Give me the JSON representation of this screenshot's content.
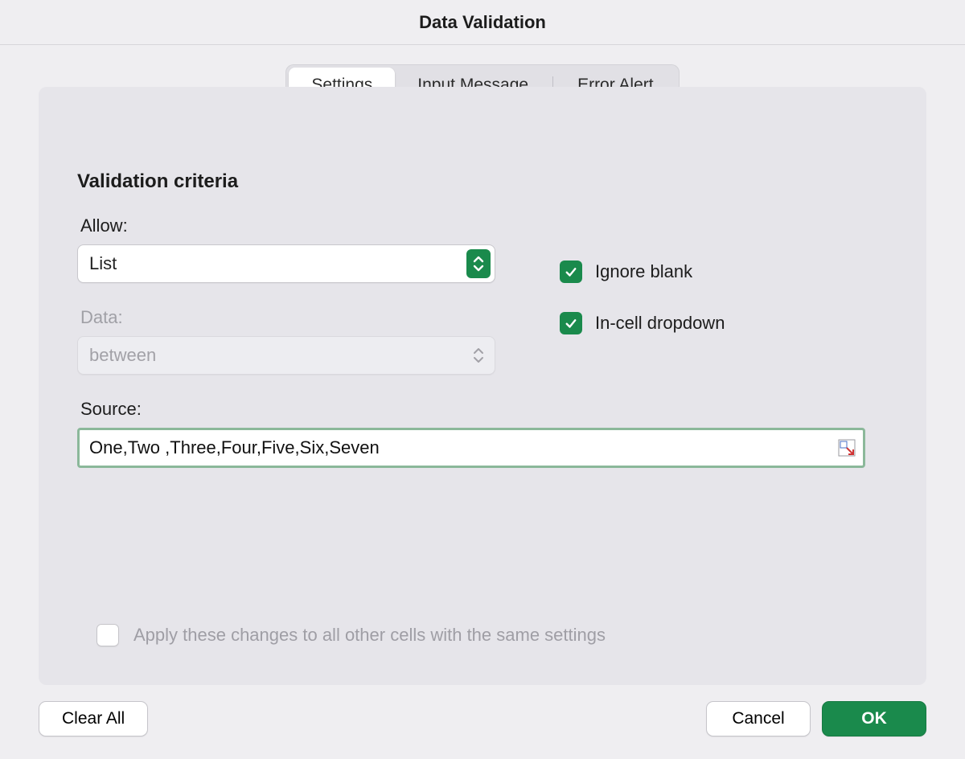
{
  "title": "Data Validation",
  "tabs": {
    "settings": "Settings",
    "input_message": "Input Message",
    "error_alert": "Error Alert"
  },
  "section_title": "Validation criteria",
  "labels": {
    "allow": "Allow:",
    "data": "Data:",
    "source": "Source:"
  },
  "allow_value": "List",
  "data_value": "between",
  "source_value": "One,Two ,Three,Four,Five,Six,Seven",
  "checks": {
    "ignore_blank": {
      "label": "Ignore blank",
      "checked": true
    },
    "in_cell_dropdown": {
      "label": "In-cell dropdown",
      "checked": true
    },
    "apply_to_all": {
      "label": "Apply these changes to all other cells with the same settings",
      "checked": false
    }
  },
  "buttons": {
    "clear_all": "Clear All",
    "cancel": "Cancel",
    "ok": "OK"
  }
}
